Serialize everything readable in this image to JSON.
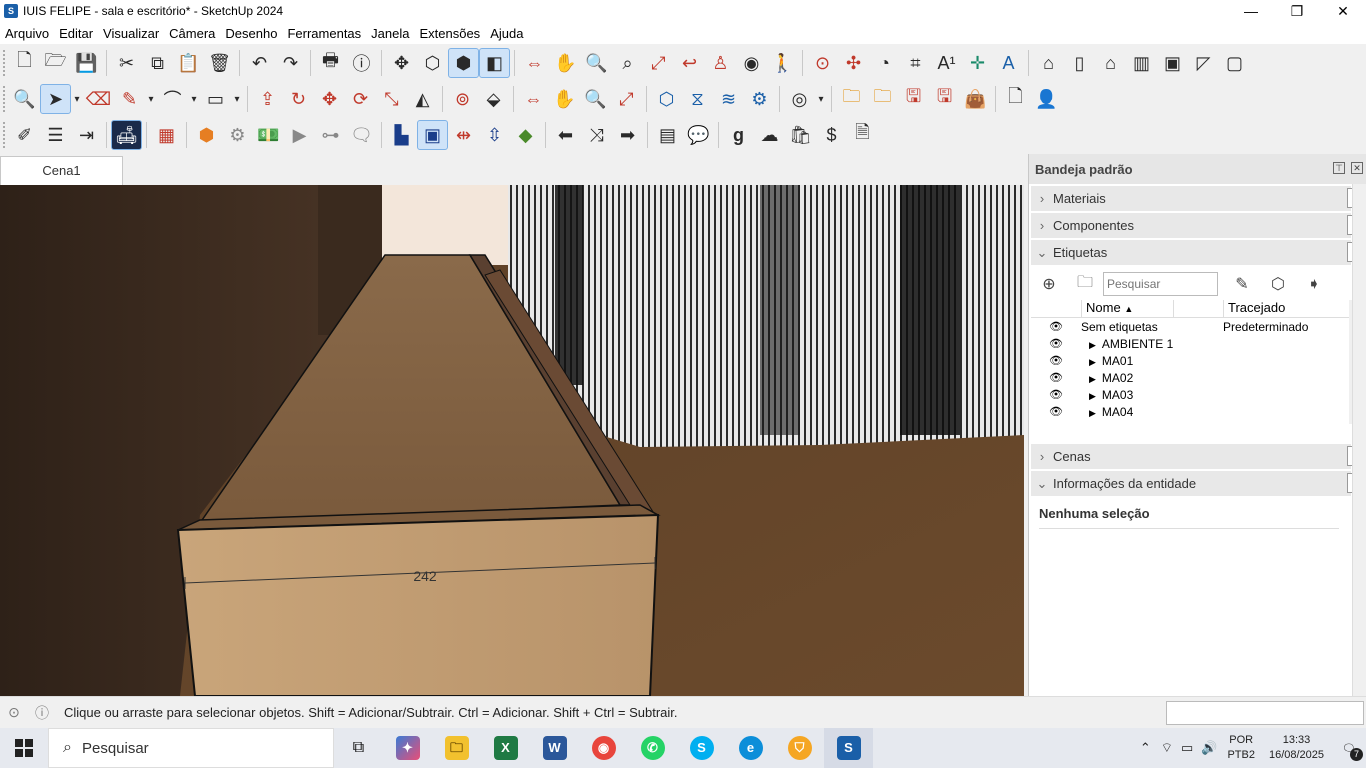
{
  "window": {
    "title": "IUIS FELIPE - sala e escritório* - SketchUp 2024",
    "minimize": "—",
    "maximize": "❐",
    "close": "✕"
  },
  "menu": [
    "Arquivo",
    "Editar",
    "Visualizar",
    "Câmera",
    "Desenho",
    "Ferramentas",
    "Janela",
    "Extensões",
    "Ajuda"
  ],
  "scene_tab": "Cena1",
  "viewport": {
    "dimension_label": "242"
  },
  "tray": {
    "title": "Bandeja padrão",
    "panels": {
      "materiais": "Materiais",
      "componentes": "Componentes",
      "etiquetas": "Etiquetas",
      "cenas": "Cenas",
      "info": "Informações da entidade"
    },
    "tags": {
      "search_placeholder": "Pesquisar",
      "col_name": "Nome",
      "col_trace": "Tracejado",
      "rows": [
        {
          "name": "Sem etiquetas",
          "trace": "Predeterminado"
        },
        {
          "name": "AMBIENTE 1",
          "trace": ""
        },
        {
          "name": "MA01",
          "trace": ""
        },
        {
          "name": "MA02",
          "trace": ""
        },
        {
          "name": "MA03",
          "trace": ""
        },
        {
          "name": "MA04",
          "trace": ""
        }
      ]
    },
    "entity_info": "Nenhuma seleção"
  },
  "status": {
    "message": "Clique ou arraste para selecionar objetos. Shift = Adicionar/Subtrair. Ctrl = Adicionar. Shift + Ctrl = Subtrair."
  },
  "taskbar": {
    "search": "Pesquisar",
    "lang1": "POR",
    "lang2": "PTB2",
    "time": "13:33",
    "date": "16/08/2025",
    "notif": "7"
  }
}
